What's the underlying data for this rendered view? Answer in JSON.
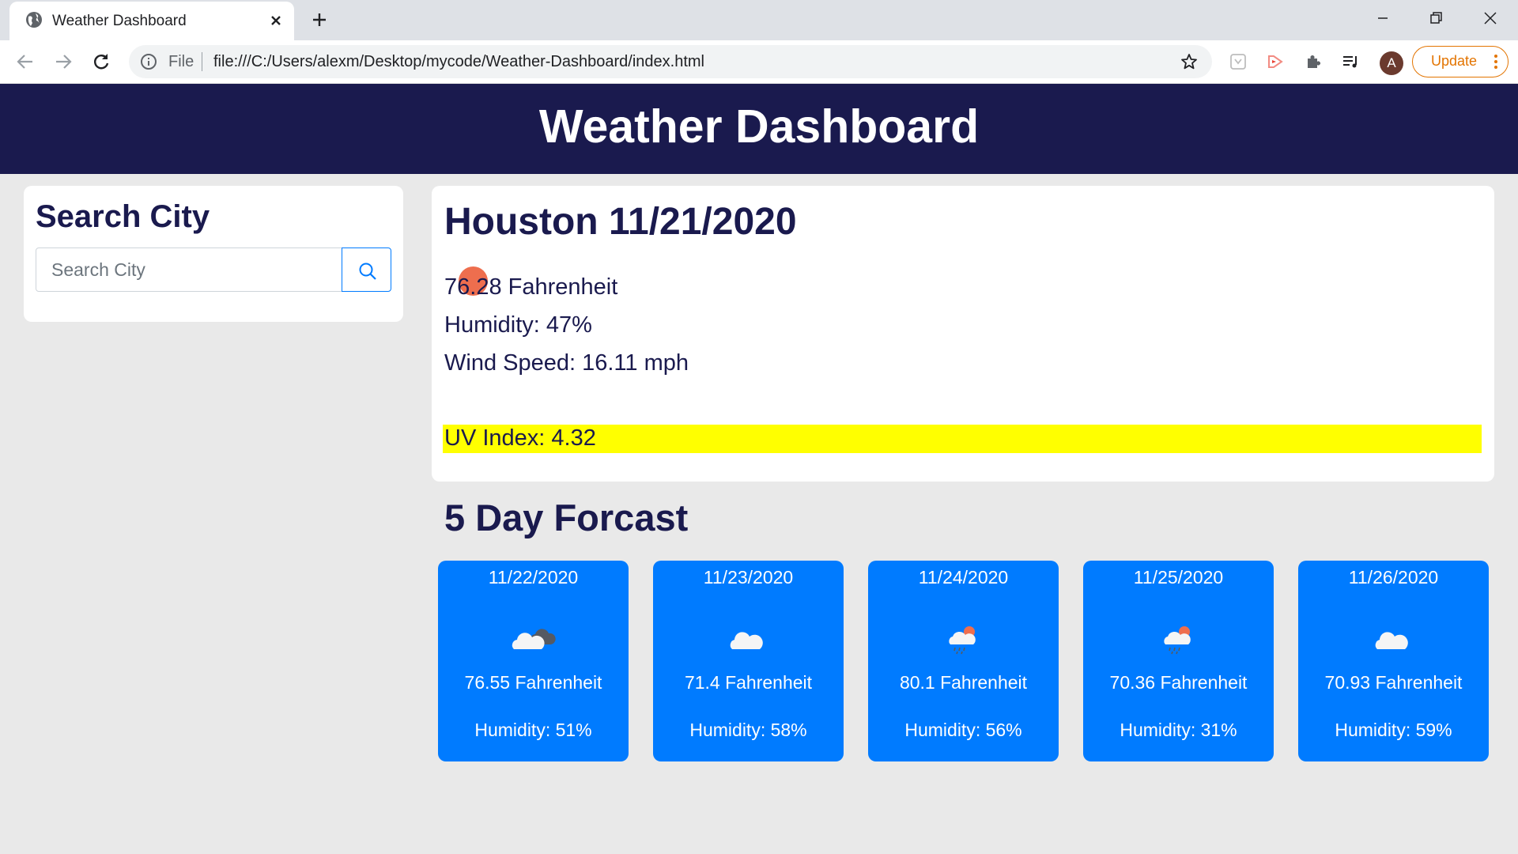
{
  "browser": {
    "tab_title": "Weather Dashboard",
    "omnibox": {
      "scheme_label": "File",
      "url": "file:///C:/Users/alexm/Desktop/mycode/Weather-Dashboard/index.html"
    },
    "profile_initial": "A",
    "update_label": "Update",
    "colors": {
      "tabbar": "#dee1e6",
      "update": "#e37400"
    }
  },
  "header": {
    "title": "Weather Dashboard",
    "color": "#1a1a4e"
  },
  "search": {
    "heading": "Search City",
    "placeholder": "Search City",
    "value": "",
    "button_icon": "search-icon",
    "button_color": "#007bff"
  },
  "current": {
    "title": "Houston 11/21/2020",
    "icon": "clear-sun-icon",
    "temperature": "76.28 Fahrenheit",
    "humidity": "Humidity: 47%",
    "wind": "Wind Speed: 16.11 mph",
    "uv": "UV Index: 4.32",
    "uv_color": "#ffff00"
  },
  "forecast": {
    "heading": "5 Day Forcast",
    "card_color": "#007bff",
    "days": [
      {
        "date": "11/22/2020",
        "icon": "broken-clouds-icon",
        "temp": "76.55 Fahrenheit",
        "humidity": "Humidity: 51%"
      },
      {
        "date": "11/23/2020",
        "icon": "cloud-icon",
        "temp": "71.4 Fahrenheit",
        "humidity": "Humidity: 58%"
      },
      {
        "date": "11/24/2020",
        "icon": "rain-sun-icon",
        "temp": "80.1 Fahrenheit",
        "humidity": "Humidity: 56%"
      },
      {
        "date": "11/25/2020",
        "icon": "rain-sun-icon",
        "temp": "70.36 Fahrenheit",
        "humidity": "Humidity: 31%"
      },
      {
        "date": "11/26/2020",
        "icon": "cloud-icon",
        "temp": "70.93 Fahrenheit",
        "humidity": "Humidity: 59%"
      }
    ]
  }
}
